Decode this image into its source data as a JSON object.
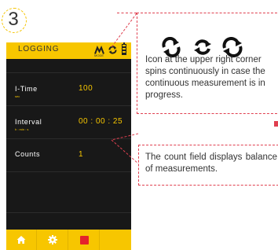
{
  "step": "3",
  "app": {
    "header": {
      "title": "LOGGING",
      "mode_label": "MODE",
      "icons": [
        "mode-icon",
        "sync-icon",
        "battery-icon"
      ]
    },
    "fields": [
      {
        "label": "I-Time",
        "unit": "sec",
        "value": "100"
      },
      {
        "label": "Interval",
        "unit": "h : min : s",
        "value": "00 : 00 : 25"
      },
      {
        "label": "Counts",
        "unit": "",
        "value": "1"
      }
    ],
    "footer": {
      "buttons": [
        "home-icon",
        "gear-icon",
        "stop-icon"
      ]
    }
  },
  "callouts": {
    "top": {
      "icons": [
        "sync-icon",
        "sync-icon",
        "sync-icon"
      ],
      "text": "Icon at the upper right corner spins continuously in case the continuous measurement is in progress."
    },
    "bottom": {
      "text": "The count field displays balance of measurements."
    }
  },
  "colors": {
    "accent": "#f7c600",
    "screen": "#181818",
    "callout": "#e04050"
  }
}
